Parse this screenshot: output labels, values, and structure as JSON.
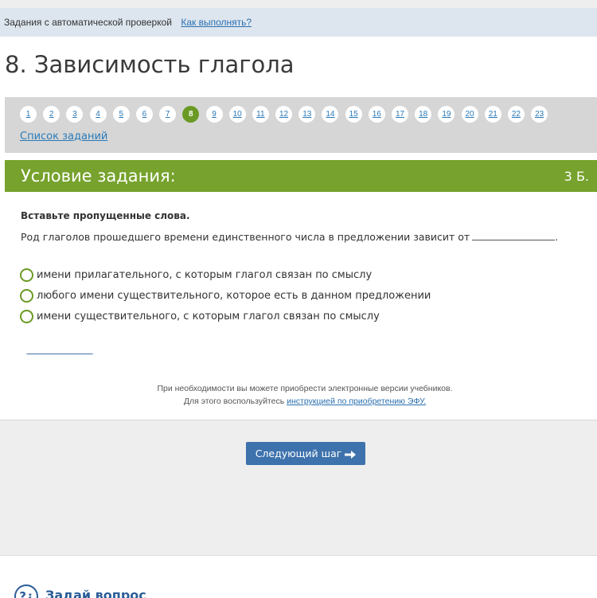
{
  "info_bar": {
    "text": "Задания с автоматической проверкой",
    "how_link": "Как выполнять?"
  },
  "page_title": "8. Зависимость глагола",
  "navigation": {
    "numbers": [
      "1",
      "2",
      "3",
      "4",
      "5",
      "6",
      "7",
      "8",
      "9",
      "10",
      "11",
      "12",
      "13",
      "14",
      "15",
      "16",
      "17",
      "18",
      "19",
      "20",
      "21",
      "22",
      "23"
    ],
    "active": "8",
    "task_list_link": "Список заданий"
  },
  "condition": {
    "header": "Условие задания:",
    "points": "3 Б.",
    "instruction": "Вставьте пропущенные слова.",
    "question": "Род глаголов прошедшего времени единственного числа в предложении зависит  от",
    "question_end": ".",
    "options": [
      "имени прилагательного, с которым глагол связан по смыслу",
      "любого имени существительного, которое есть в данном предложении",
      "имени существительного, с которым глагол связан по смыслу"
    ]
  },
  "footer_note": {
    "line1": "При необходимости вы можете приобрести электронные версии учебников.",
    "line2_prefix": "Для этого воспользуйтесь",
    "line2_link": "инструкцией по приобретению ЭФУ."
  },
  "next_button": "Следующий шаг",
  "ask": {
    "icon": "?¿",
    "label": "Задай вопрос"
  },
  "colors": {
    "accent_green": "#77a22d",
    "link_blue": "#2a7ab8",
    "button_blue": "#3e72ad"
  }
}
